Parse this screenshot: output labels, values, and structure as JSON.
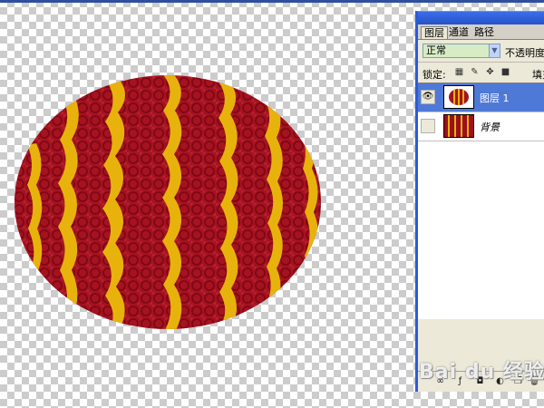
{
  "panel": {
    "tabs": [
      {
        "label": "图层"
      },
      {
        "label": "通道"
      },
      {
        "label": "路径"
      }
    ],
    "blend_mode": "正常",
    "opacity_label": "不透明度",
    "lock_label": "锁定:",
    "fill_label": "填充",
    "layers": [
      {
        "name": "图层 1",
        "selected": true,
        "visible": true
      },
      {
        "name": "背景",
        "selected": false,
        "visible": false
      }
    ]
  },
  "icons": {
    "eye": "eye-icon",
    "lock_transparent": "checker-icon",
    "lock_paint": "brush-icon",
    "lock_move": "move-icon",
    "lock_all": "lock-icon",
    "dropdown": "chevron-down-icon",
    "bottom": [
      "link-icon",
      "effects-icon",
      "mask-icon",
      "adjustment-icon",
      "new-layer-icon",
      "trash-icon"
    ]
  },
  "colors": {
    "ball_red": "#a0101e",
    "stripe_gold": "#e8b20c",
    "selection_blue": "#4f79d6"
  },
  "watermark": "Bai du 经验"
}
